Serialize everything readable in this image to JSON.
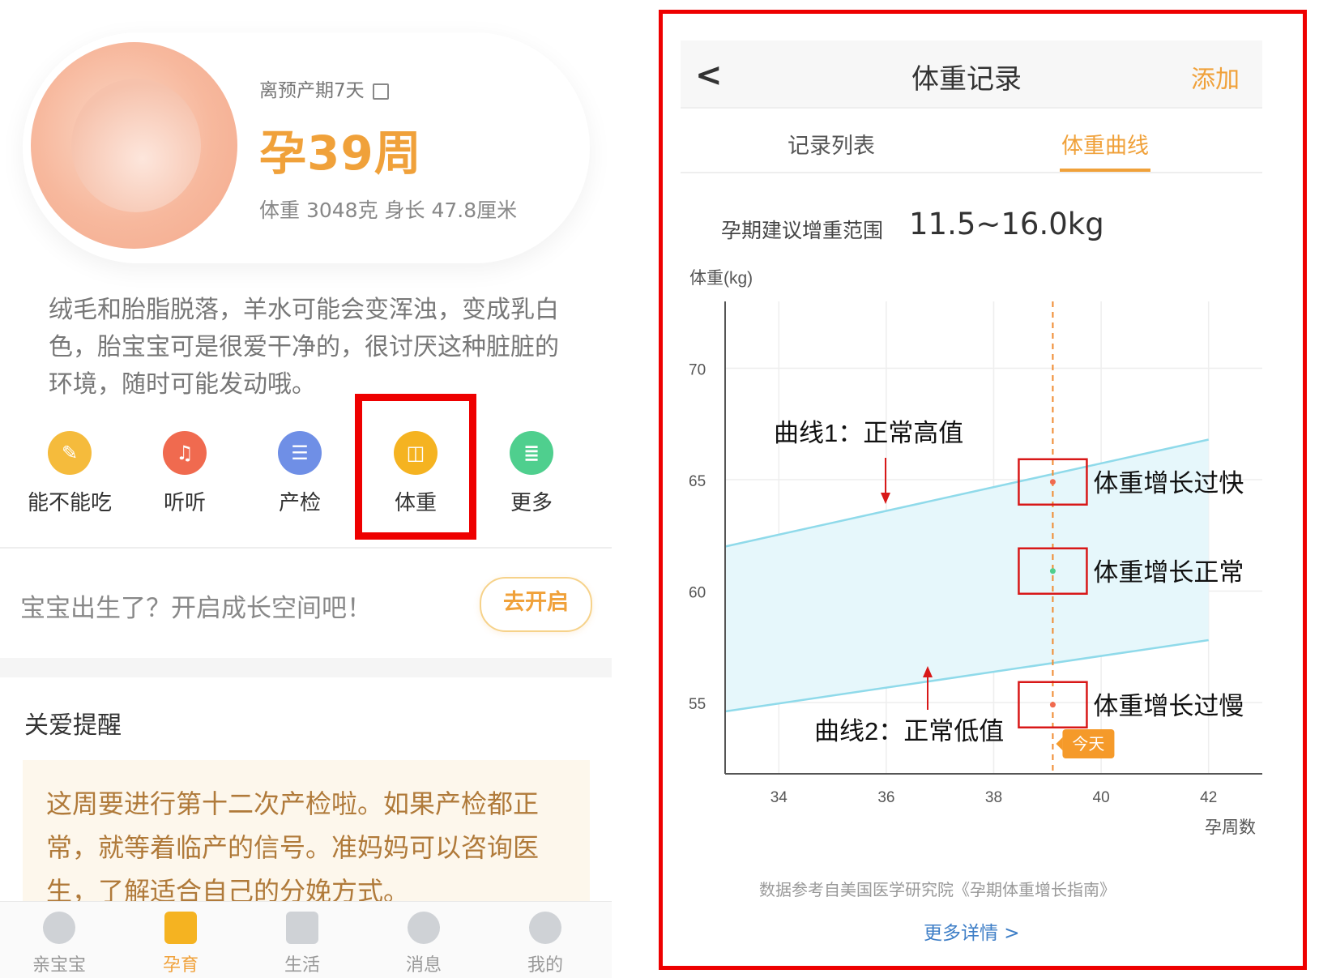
{
  "left": {
    "due_text": "离预产期7天",
    "week": "孕39周",
    "size": "体重 3048克  身长 47.8厘米",
    "description": "绒毛和胎脂脱落，羊水可能会变浑浊，变成乳白色，胎宝宝可是很爱干净的，很讨厌这种脏脏的环境，随时可能发动哦。",
    "quick": [
      {
        "label": "能不能吃",
        "icon": "carrot-icon",
        "color": "#f5bb3c"
      },
      {
        "label": "听听",
        "icon": "music-icon",
        "color": "#f06a4f"
      },
      {
        "label": "产检",
        "icon": "checkup-icon",
        "color": "#6f8fe6"
      },
      {
        "label": "体重",
        "icon": "scale-icon",
        "color": "#f5b321"
      },
      {
        "label": "更多",
        "icon": "more-icon",
        "color": "#4fcf8e"
      }
    ],
    "born_prompt": "宝宝出生了？开启成长空间吧！",
    "go_button": "去开启",
    "care_title": "关爱提醒",
    "care_text": "这周要进行第十二次产检啦。如果产检都正常，就等着临产的信号。准妈妈可以咨询医生，了解适合自己的分娩方式。",
    "tabs": [
      {
        "label": "亲宝宝",
        "icon": "baby-face-icon"
      },
      {
        "label": "孕育",
        "icon": "menu-icon",
        "active": true
      },
      {
        "label": "生活",
        "icon": "bag-icon"
      },
      {
        "label": "消息",
        "icon": "chat-icon"
      },
      {
        "label": "我的",
        "icon": "person-icon"
      }
    ],
    "accent": "#f0a13a"
  },
  "right": {
    "nav": {
      "back": "<",
      "title": "体重记录",
      "add": "添加"
    },
    "segments": [
      "记录列表",
      "体重曲线"
    ],
    "range_label": "孕期建议增重范围",
    "range_value": "11.5~16.0kg",
    "source": "数据参考自美国医学研究院《孕期体重增长指南》",
    "more": "更多详情 >"
  },
  "chart_data": {
    "type": "area",
    "ylabel": "体重(kg)",
    "xlabel": "孕周数",
    "x_ticks": [
      34,
      36,
      38,
      40,
      42
    ],
    "y_ticks": [
      55,
      60,
      65,
      70
    ],
    "xlim": [
      33,
      43
    ],
    "ylim": [
      51.8,
      73
    ],
    "series": [
      {
        "name": "曲线1：正常高值",
        "x": [
          33,
          42
        ],
        "values": [
          62.0,
          66.8
        ]
      },
      {
        "name": "曲线2：正常低值",
        "x": [
          33,
          42
        ],
        "values": [
          54.6,
          57.8
        ]
      }
    ],
    "band_color": "#e6f7fb",
    "line_color": "#8fdaea",
    "today_x": 39.1,
    "today_label": "今天",
    "points": [
      {
        "label": "体重增长过快",
        "x": 39.1,
        "y": 64.9
      },
      {
        "label": "体重增长正常",
        "x": 39.1,
        "y": 60.9
      },
      {
        "label": "体重增长过慢",
        "x": 39.1,
        "y": 54.9
      }
    ],
    "grid": true
  }
}
